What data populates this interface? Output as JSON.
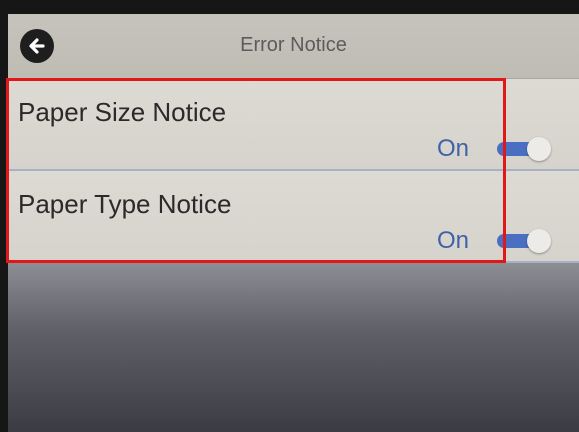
{
  "header": {
    "title": "Error Notice",
    "back_icon": "arrow-left-icon"
  },
  "settings": [
    {
      "label": "Paper Size Notice",
      "value": "On",
      "toggle_on": true
    },
    {
      "label": "Paper Type Notice",
      "value": "On",
      "toggle_on": true
    }
  ],
  "colors": {
    "accent": "#4a6fc2",
    "value_text": "#3f62a8",
    "highlight": "#e01818"
  }
}
